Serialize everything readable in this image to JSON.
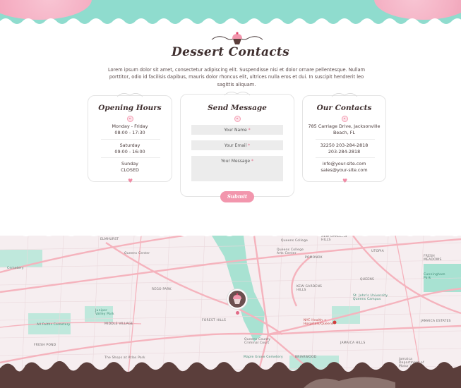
{
  "section": {
    "title": "Dessert Contacts",
    "intro": "Lorem ipsum dolor sit amet, consectetur adipiscing elit. Suspendisse nisi et dolor ornare pellentesque. Nullam porttitor, odio id facilisis dapibus, mauris dolor rhoncus elit, ultrices nulla eros et dui. In suscipit hendrerit leo sagittis aliquam."
  },
  "hours": {
    "title": "Opening Hours",
    "weekday_days": "Monday - Friday",
    "weekday_time": "08:00 - 17:30",
    "saturday_day": "Saturday",
    "saturday_time": "09:00 - 16:00",
    "sunday_day": "Sunday",
    "sunday_time": "CLOSED"
  },
  "message": {
    "title": "Send Message",
    "name_placeholder": "Your Name",
    "email_placeholder": "Your Email",
    "message_placeholder": "Your Message",
    "required_mark": "*",
    "submit_label": "Submit"
  },
  "contacts": {
    "title": "Our Contacts",
    "address_line1": "785 Carriage Drive, Jacksonville",
    "address_line2": "Beach, FL",
    "phone1": "32250 203-284-2818",
    "phone2": "203-284-2818",
    "email1": "info@your-site.com",
    "email2": "sales@your-site.com"
  },
  "map": {
    "labels": [
      "ELMHURST",
      "Queens Center",
      "REGO PARK",
      "Juniper Valley Park",
      "MIDDLE VILLAGE",
      "All Faiths Cemetery",
      "FRESH POND",
      "FOREST HILLS",
      "Queens College",
      "Queens College Arts Center",
      "POMONOX",
      "KEW GARDENS HILLS",
      "UTOPIA",
      "FRESH MEADOWS",
      "QUEENS",
      "Cunningham Park",
      "St. John's University Queens Campus",
      "NYC Health + Hospitals/Queens",
      "JAMAICA ESTATES",
      "KEW GARDENS",
      "Queens County Criminal Court",
      "BRIARWOOD",
      "Maple Grove Cemetery",
      "JAMAICA HILLS",
      "Jamaica Department of Motor Vehicles",
      "The Shops at Atlas Park",
      "Cemetery",
      "NEW GARDENS HILLS"
    ]
  },
  "colors": {
    "accent_pink": "#f296ad",
    "mint": "#8fdcce",
    "chocolate": "#5b3e3b",
    "map_road": "#f5b3bd"
  }
}
